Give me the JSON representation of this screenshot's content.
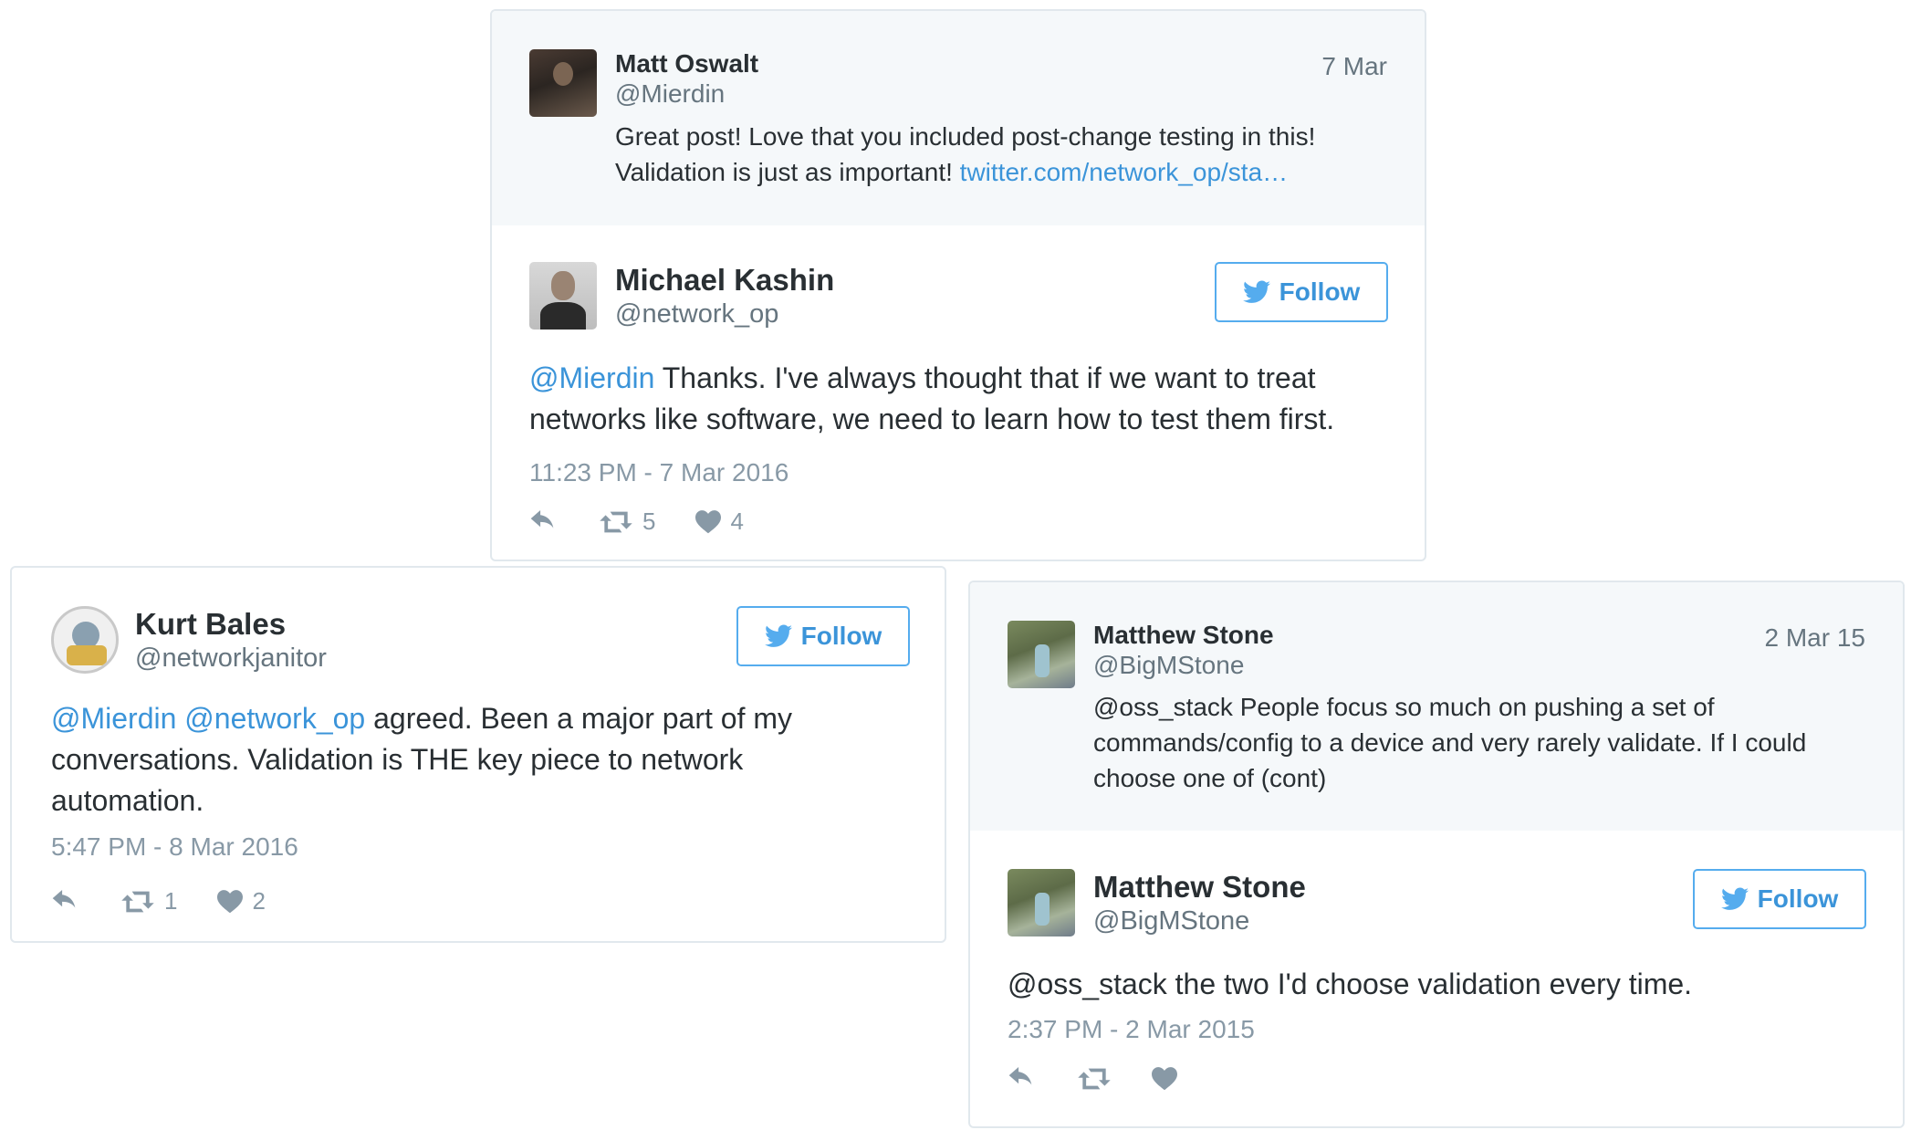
{
  "tweet1": {
    "parent": {
      "name": "Matt Oswalt",
      "handle": "@Mierdin",
      "date": "7 Mar",
      "text": "Great post! Love that you included post-change testing in this!",
      "text2": "Validation is just as important!",
      "link": "twitter.com/network_op/sta…"
    },
    "main": {
      "name": "Michael Kashin",
      "handle": "@network_op",
      "follow_label": "Follow",
      "mention": "@Mierdin",
      "text": " Thanks. I've always thought that if we want to treat networks like software, we need to learn how to test them first.",
      "timestamp": "11:23 PM - 7 Mar 2016",
      "retweets": "5",
      "likes": "4"
    }
  },
  "tweet2": {
    "name": "Kurt Bales",
    "handle": "@networkjanitor",
    "follow_label": "Follow",
    "mention1": "@Mierdin",
    "mention2": "@network_op",
    "text": " agreed. Been a major part of my conversations. Validation is THE key piece to network automation.",
    "timestamp": "5:47 PM - 8 Mar 2016",
    "retweets": "1",
    "likes": "2"
  },
  "tweet3": {
    "parent": {
      "name": "Matthew Stone",
      "handle": "@BigMStone",
      "date": "2 Mar 15",
      "text": "@oss_stack People focus so much on pushing a set of commands/config to a device and very rarely validate. If I could choose one of (cont)"
    },
    "main": {
      "name": "Matthew Stone",
      "handle": "@BigMStone",
      "follow_label": "Follow",
      "text": "@oss_stack the two I'd choose validation every time.",
      "timestamp": "2:37 PM - 2 Mar 2015"
    }
  },
  "colors": {
    "link": "#3b94d9",
    "border": "#e1e8ed",
    "parent_bg": "#f5f8fa",
    "muted": "#66757f"
  },
  "icons": [
    "reply-icon",
    "retweet-icon",
    "heart-icon",
    "twitter-bird-icon"
  ]
}
